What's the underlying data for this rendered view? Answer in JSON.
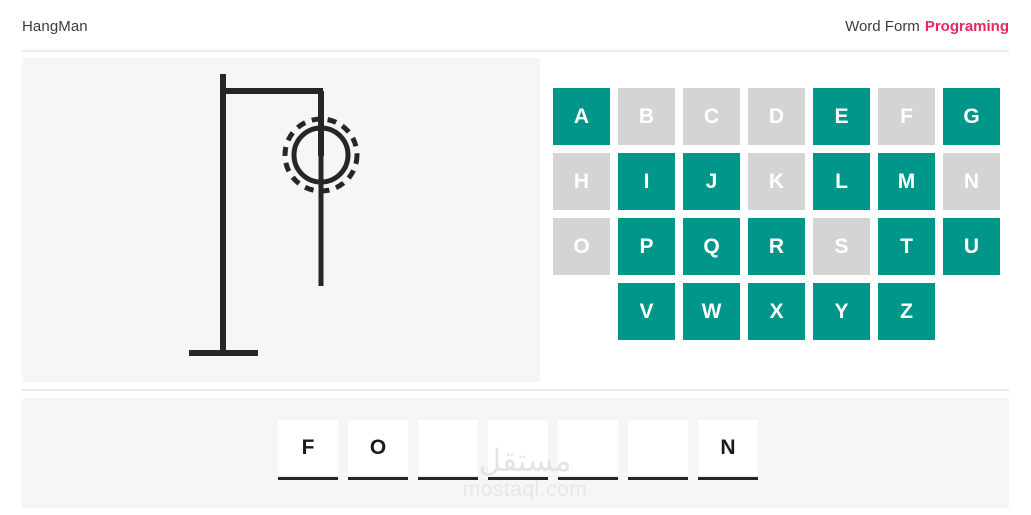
{
  "header": {
    "app_title": "HangMan",
    "word_form_label": "Word Form",
    "word_value": "Programing"
  },
  "colors": {
    "accent_teal": "#00968a",
    "used_gray": "#d4d4d4",
    "word_value_pink": "#e8285f",
    "panel_bg": "#f6f6f6",
    "stroke_dark": "#262626"
  },
  "gallows": {
    "parts_drawn": [
      "post",
      "beam",
      "rope",
      "head",
      "body"
    ],
    "head_style": "dashed-ring"
  },
  "keyboard": {
    "rows": [
      [
        {
          "letter": "A",
          "state": "active"
        },
        {
          "letter": "B",
          "state": "used"
        },
        {
          "letter": "C",
          "state": "used"
        },
        {
          "letter": "D",
          "state": "used"
        },
        {
          "letter": "E",
          "state": "active"
        },
        {
          "letter": "F",
          "state": "used"
        },
        {
          "letter": "G",
          "state": "active"
        }
      ],
      [
        {
          "letter": "H",
          "state": "used"
        },
        {
          "letter": "I",
          "state": "active"
        },
        {
          "letter": "J",
          "state": "active"
        },
        {
          "letter": "K",
          "state": "used"
        },
        {
          "letter": "L",
          "state": "active"
        },
        {
          "letter": "M",
          "state": "active"
        },
        {
          "letter": "N",
          "state": "used"
        }
      ],
      [
        {
          "letter": "O",
          "state": "used"
        },
        {
          "letter": "P",
          "state": "active"
        },
        {
          "letter": "Q",
          "state": "active"
        },
        {
          "letter": "R",
          "state": "active"
        },
        {
          "letter": "S",
          "state": "used"
        },
        {
          "letter": "T",
          "state": "active"
        },
        {
          "letter": "U",
          "state": "active"
        }
      ],
      [
        {
          "letter": "V",
          "state": "active"
        },
        {
          "letter": "W",
          "state": "active"
        },
        {
          "letter": "X",
          "state": "active"
        },
        {
          "letter": "Y",
          "state": "active"
        },
        {
          "letter": "Z",
          "state": "active"
        }
      ]
    ],
    "row_offsets": [
      0,
      0,
      0,
      1
    ]
  },
  "word": {
    "slots": [
      "F",
      "O",
      "",
      "",
      "",
      "",
      "N"
    ]
  },
  "watermark": {
    "arabic": "مستقل",
    "latin": "mostaql.com"
  }
}
